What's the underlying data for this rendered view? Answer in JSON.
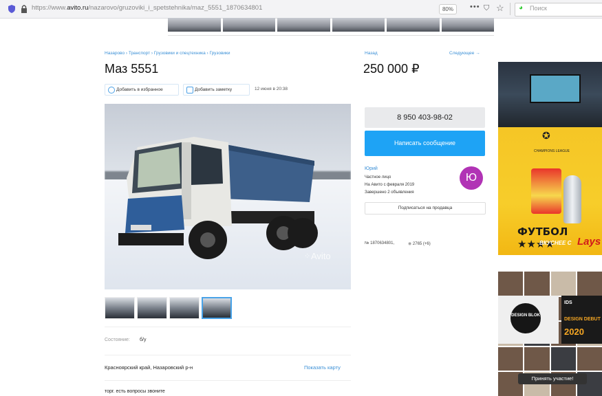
{
  "browser": {
    "url_prefix": "https://www.",
    "url_domain": "avito.ru",
    "url_path": "/nazarovo/gruzoviki_i_spetstehnika/maz_5551_1870634801",
    "zoom": "80%",
    "search_placeholder": "Поиск"
  },
  "listing": {
    "breadcrumbs": "Назарово › Транспорт › Грузовики и спецтехника › Грузовики",
    "title": "Маз 5551",
    "add_favorite": "Добавить в избранное",
    "add_note": "Добавить заметку",
    "posted": "12 июня в 20:38",
    "photo_watermark": "Avito",
    "condition_label": "Состояние:",
    "condition_value": "б/у",
    "address": "Красноярский край, Назаровский р-н",
    "show_map": "Показать карту",
    "description": "торг. есть вопросы звоните"
  },
  "sidebar": {
    "note_link": "Назад",
    "next_link": "Следующее →",
    "price": "250 000 ₽",
    "phone": "8 950 403-98-02",
    "message_button": "Написать сообщение",
    "seller_name": "Юрий",
    "seller_type": "Частное лицо",
    "seller_since": "На Авито с февраля 2019",
    "seller_count": "Завершено 2 объявления",
    "avatar_letter": "Ю",
    "subscribe": "Подписаться на продавца",
    "ad_id": "№ 1870634801,",
    "views": "2765 (+6)"
  },
  "ads": {
    "ad1_ucl": "CHAMPIONS LEAGUE",
    "ad1_line1": "ФУТБОЛ ★★★★",
    "ad1_line2": "ВКУСНЕЕ С",
    "ad1_brand": "Lays",
    "ad2_circle": "DESIGN BLOK",
    "ad2_ids": "IDS",
    "ad2_debut": "DESIGN DEBUT",
    "ad2_year": "2020",
    "ad2_button": "Принять участие!"
  },
  "colors": {
    "accent": "#1ea3f5",
    "link": "#3a8fd6",
    "avatar": "#b133b5"
  }
}
